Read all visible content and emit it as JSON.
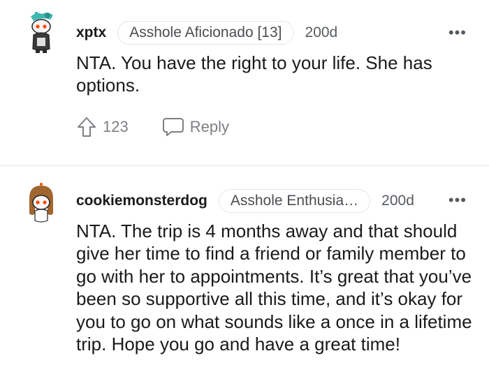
{
  "comments": [
    {
      "username": "xptx",
      "flair": "Asshole Aficionado [13]",
      "age": "200d",
      "text": "NTA. You have the right to your life. She has options.",
      "upvotes": "123",
      "reply_label": "Reply",
      "avatar_icon": "snoo-avatar-teal-hat-icon"
    },
    {
      "username": "cookiemonsterdog",
      "flair": "Asshole Enthusia…",
      "age": "200d",
      "text": "NTA. The trip is 4 months away and that should give her time to find a friend or family member to go with her to appointments. It’s great that you’ve been so supportive all this time, and it’s okay for you to go on what sounds like a once in a lifetime trip. Hope you go and have a great time!",
      "avatar_icon": "snoo-avatar-brown-hair-icon"
    }
  ],
  "icons": {
    "more": "more-options-icon",
    "upvote": "upvote-arrow-icon",
    "reply": "reply-bubble-icon"
  },
  "colors": {
    "text": "#1a1a1b",
    "meta": "#555b60",
    "action": "#7c7f84",
    "divider": "#edeff1",
    "flair_border": "#e3e5e8"
  }
}
